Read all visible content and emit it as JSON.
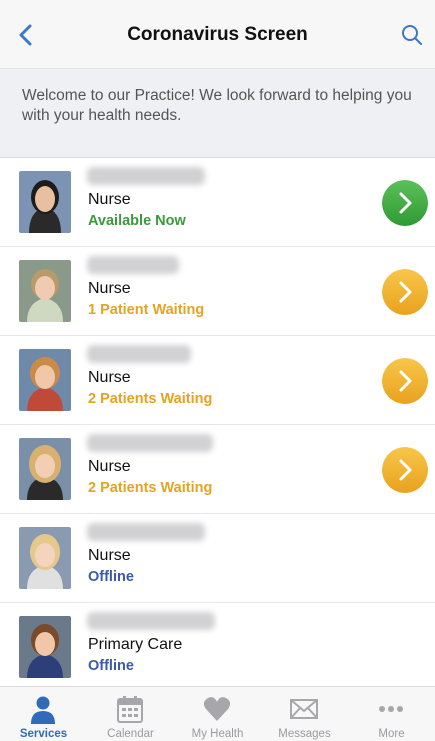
{
  "header": {
    "title": "Coronavirus Screen",
    "back_icon": "chevron-left-icon",
    "search_icon": "search-icon",
    "accent": "#3a78c8"
  },
  "welcome": {
    "text": "Welcome to our Practice! We look forward to helping you with your health needs."
  },
  "providers": [
    {
      "role": "Nurse",
      "status": "Available Now",
      "status_color": "#3a9a3a",
      "action": "green",
      "name_obscured": true
    },
    {
      "role": "Nurse",
      "status": "1 Patient Waiting",
      "status_color": "#e5a320",
      "action": "orange",
      "name_obscured": true
    },
    {
      "role": "Nurse",
      "status": "2 Patients Waiting",
      "status_color": "#e5a320",
      "action": "orange",
      "name_obscured": true
    },
    {
      "role": "Nurse",
      "status": "2 Patients Waiting",
      "status_color": "#e5a320",
      "action": "orange",
      "name_obscured": true
    },
    {
      "role": "Nurse",
      "status": "Offline",
      "status_color": "#3b5aa8",
      "action": "none",
      "name_obscured": true
    },
    {
      "role": "Primary Care",
      "status": "Offline",
      "status_color": "#3b5aa8",
      "action": "none",
      "name_obscured": true
    }
  ],
  "tabbar": {
    "tabs": [
      {
        "label": "Services",
        "icon": "person-icon",
        "active": true
      },
      {
        "label": "Calendar",
        "icon": "calendar-icon",
        "active": false
      },
      {
        "label": "My Health",
        "icon": "heart-icon",
        "active": false
      },
      {
        "label": "Messages",
        "icon": "envelope-icon",
        "active": false
      },
      {
        "label": "More",
        "icon": "more-dots-icon",
        "active": false
      }
    ]
  }
}
